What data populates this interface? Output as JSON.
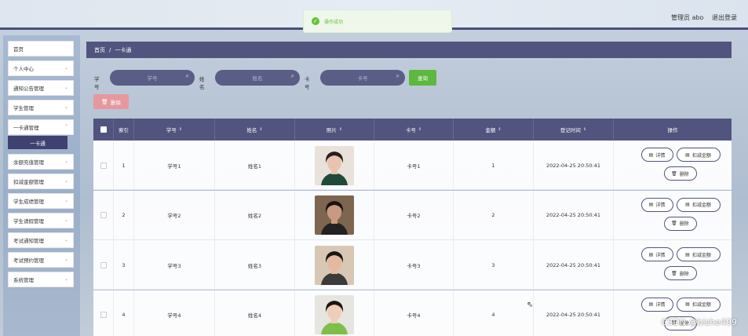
{
  "header": {
    "user_label": "管理员 abo",
    "logout_label": "退出登录"
  },
  "toast": {
    "icon": "check-circle-icon",
    "message": "操作成功",
    "color": "#67c23a"
  },
  "sidebar": {
    "items": [
      {
        "label": "首页",
        "has_children": false
      },
      {
        "label": "个人中心",
        "has_children": true
      },
      {
        "label": "通知公告管理",
        "has_children": true
      },
      {
        "label": "学生管理",
        "has_children": true
      },
      {
        "label": "一卡通管理",
        "has_children": true
      },
      {
        "label": "余额充值管理",
        "has_children": true
      },
      {
        "label": "扣减金额管理",
        "has_children": true
      },
      {
        "label": "学生成绩管理",
        "has_children": true
      },
      {
        "label": "学生请假管理",
        "has_children": true
      },
      {
        "label": "考试通知管理",
        "has_children": true
      },
      {
        "label": "考试预约管理",
        "has_children": true
      },
      {
        "label": "系统管理",
        "has_children": true
      }
    ],
    "active_sub": "一卡通"
  },
  "breadcrumb": {
    "home": "首页",
    "separator": "/",
    "current": "一卡通"
  },
  "search": {
    "fields": [
      {
        "label": "学号",
        "placeholder": "学号"
      },
      {
        "label": "姓名",
        "placeholder": "姓名"
      },
      {
        "label": "卡号",
        "placeholder": "卡号"
      }
    ],
    "query_label": "查询"
  },
  "toolbar": {
    "delete_label": "删除"
  },
  "table": {
    "headers": [
      "索引",
      "学号",
      "姓名",
      "照片",
      "卡号",
      "金额",
      "登记时间",
      "操作"
    ],
    "rows": [
      {
        "index": "1",
        "student_no": "学号1",
        "name": "姓名1",
        "card_no": "卡号1",
        "amount": "1",
        "time": "2022-04-25 20:50:41"
      },
      {
        "index": "2",
        "student_no": "学号2",
        "name": "姓名2",
        "card_no": "卡号2",
        "amount": "2",
        "time": "2022-04-25 20:50:41"
      },
      {
        "index": "3",
        "student_no": "学号3",
        "name": "姓名3",
        "card_no": "卡号3",
        "amount": "3",
        "time": "2022-04-25 20:50:41"
      },
      {
        "index": "4",
        "student_no": "学号4",
        "name": "姓名4",
        "card_no": "卡号4",
        "amount": "4",
        "time": "2022-04-25 20:50:41"
      }
    ],
    "actions": {
      "detail": "详情",
      "deduct": "扣减金额",
      "delete": "删除"
    }
  },
  "watermark": "CSDN @bishe409",
  "colors": {
    "accent": "#50547e",
    "success": "#5cb83e",
    "danger": "#e5999e"
  }
}
